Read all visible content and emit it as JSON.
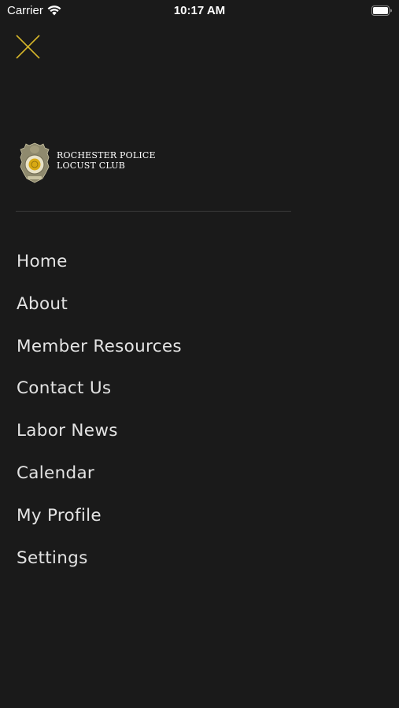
{
  "status_bar": {
    "carrier": "Carrier",
    "time": "10:17 AM"
  },
  "header": {
    "close_icon": "close-icon",
    "accent_color": "#d4b52a"
  },
  "logo": {
    "line1": "ROCHESTER POLICE",
    "line2": "LOCUST CLUB",
    "badge_icon": "police-badge-icon"
  },
  "menu": {
    "items": [
      {
        "label": "Home"
      },
      {
        "label": "About"
      },
      {
        "label": "Member Resources"
      },
      {
        "label": "Contact Us"
      },
      {
        "label": "Labor News"
      },
      {
        "label": "Calendar"
      },
      {
        "label": "My Profile"
      },
      {
        "label": "Settings"
      }
    ]
  }
}
